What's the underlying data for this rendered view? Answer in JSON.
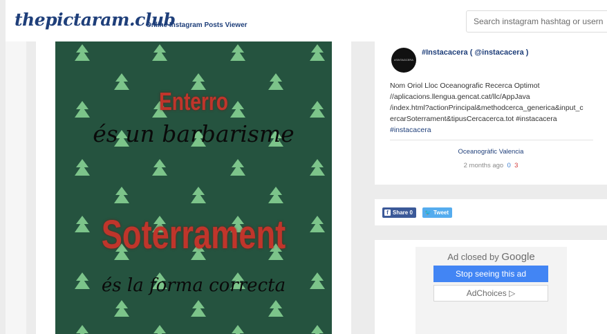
{
  "header": {
    "logo": "thepictaram.club",
    "tagline": "Online Instagram Posts Viewer",
    "search_placeholder": "Search instagram hashtag or username"
  },
  "image": {
    "line1": "Enterro",
    "line2": "és un barbarisme",
    "line3": "Soterrament",
    "line4": "és la forma correcta",
    "colors": {
      "background": "#25533f",
      "red": "#c0352b",
      "tree": "#7cc48a"
    }
  },
  "post": {
    "avatar_text": "#SINTAGCERA",
    "user": "#Instacacera ( @instacacera )",
    "caption_lines": [
      "Nom Oriol Lloc Oceanografic Recerca Optimot",
      "//aplicacions.llengua.gencat.cat/llc/AppJava",
      "/index.html?actionPrincipal&methodcerca_generica&input_c",
      "ercarSoterrament&tipusCercacerca.tot #instacacera"
    ],
    "hashtag": "#instacacera",
    "location": "Oceanogràfic Valencia",
    "time": "2 months ago",
    "likes": "0",
    "comments": "3"
  },
  "share": {
    "facebook_label": "Share 0",
    "tweet_label": "Tweet"
  },
  "ad": {
    "closed_by": "Ad closed by",
    "google": "Google",
    "stop_label": "Stop seeing this ad",
    "choices_label": "AdChoices ▷"
  }
}
